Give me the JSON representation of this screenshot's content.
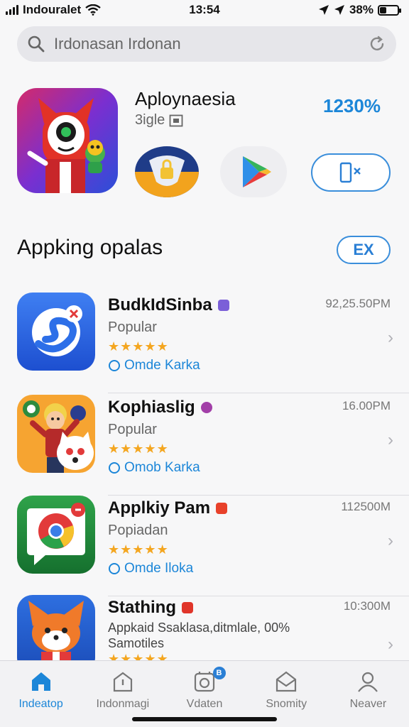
{
  "status_bar": {
    "carrier": "Indouralet",
    "time": "13:54",
    "battery": "38%",
    "battery_level": 0.38
  },
  "search": {
    "text": "Irdonasan Irdonan",
    "icon": "search-icon",
    "refresh_icon": "refresh-icon"
  },
  "featured": {
    "title": "Aploynaesia",
    "subtitle": "3igle",
    "percentage": "1230%",
    "icon": "red-monster-app-icon",
    "icons": [
      "shield-app-icon",
      "play-store-icon",
      "phone-x-icon"
    ]
  },
  "section": {
    "title": "Appking opalas",
    "button_label": "EX"
  },
  "apps": [
    {
      "name": "BudkIdSinba",
      "category": "Popular",
      "rating": 4.5,
      "meta": "Omde Karka",
      "size": "92,25.50PM",
      "badge_color": "#7b5fd8",
      "icon": "blue-swirl-app-icon"
    },
    {
      "name": "Kophiaslig",
      "category": "Popular",
      "rating": 4.5,
      "meta": "Omob Karka",
      "size": "16.00PM",
      "badge_color": "#a23fa8",
      "icon": "cartoon-characters-app-icon"
    },
    {
      "name": "Applkiy Pam",
      "category": "Popiadan",
      "rating": 4.5,
      "meta": "Omde Iloka",
      "size": "112500M",
      "badge_color": "#e8412a",
      "icon": "chrome-chat-app-icon"
    },
    {
      "name": "Stathing",
      "category": "Appkaid Ssaklasa,ditmlale, 00%",
      "category2": "Samotiles",
      "rating": 4.5,
      "size": "10:300M",
      "badge_color": "#e0352a",
      "icon": "fox-app-icon"
    }
  ],
  "tabs": [
    {
      "label": "Indeatop",
      "icon": "home-icon",
      "active": true
    },
    {
      "label": "Indonmagi",
      "icon": "today-icon",
      "active": false
    },
    {
      "label": "Vdaten",
      "icon": "apps-icon",
      "active": false,
      "badge": "B"
    },
    {
      "label": "Snomity",
      "icon": "updates-icon",
      "active": false
    },
    {
      "label": "Neaver",
      "icon": "profile-icon",
      "active": false
    }
  ],
  "colors": {
    "accent": "#1c86d8",
    "star": "#f4a620"
  }
}
